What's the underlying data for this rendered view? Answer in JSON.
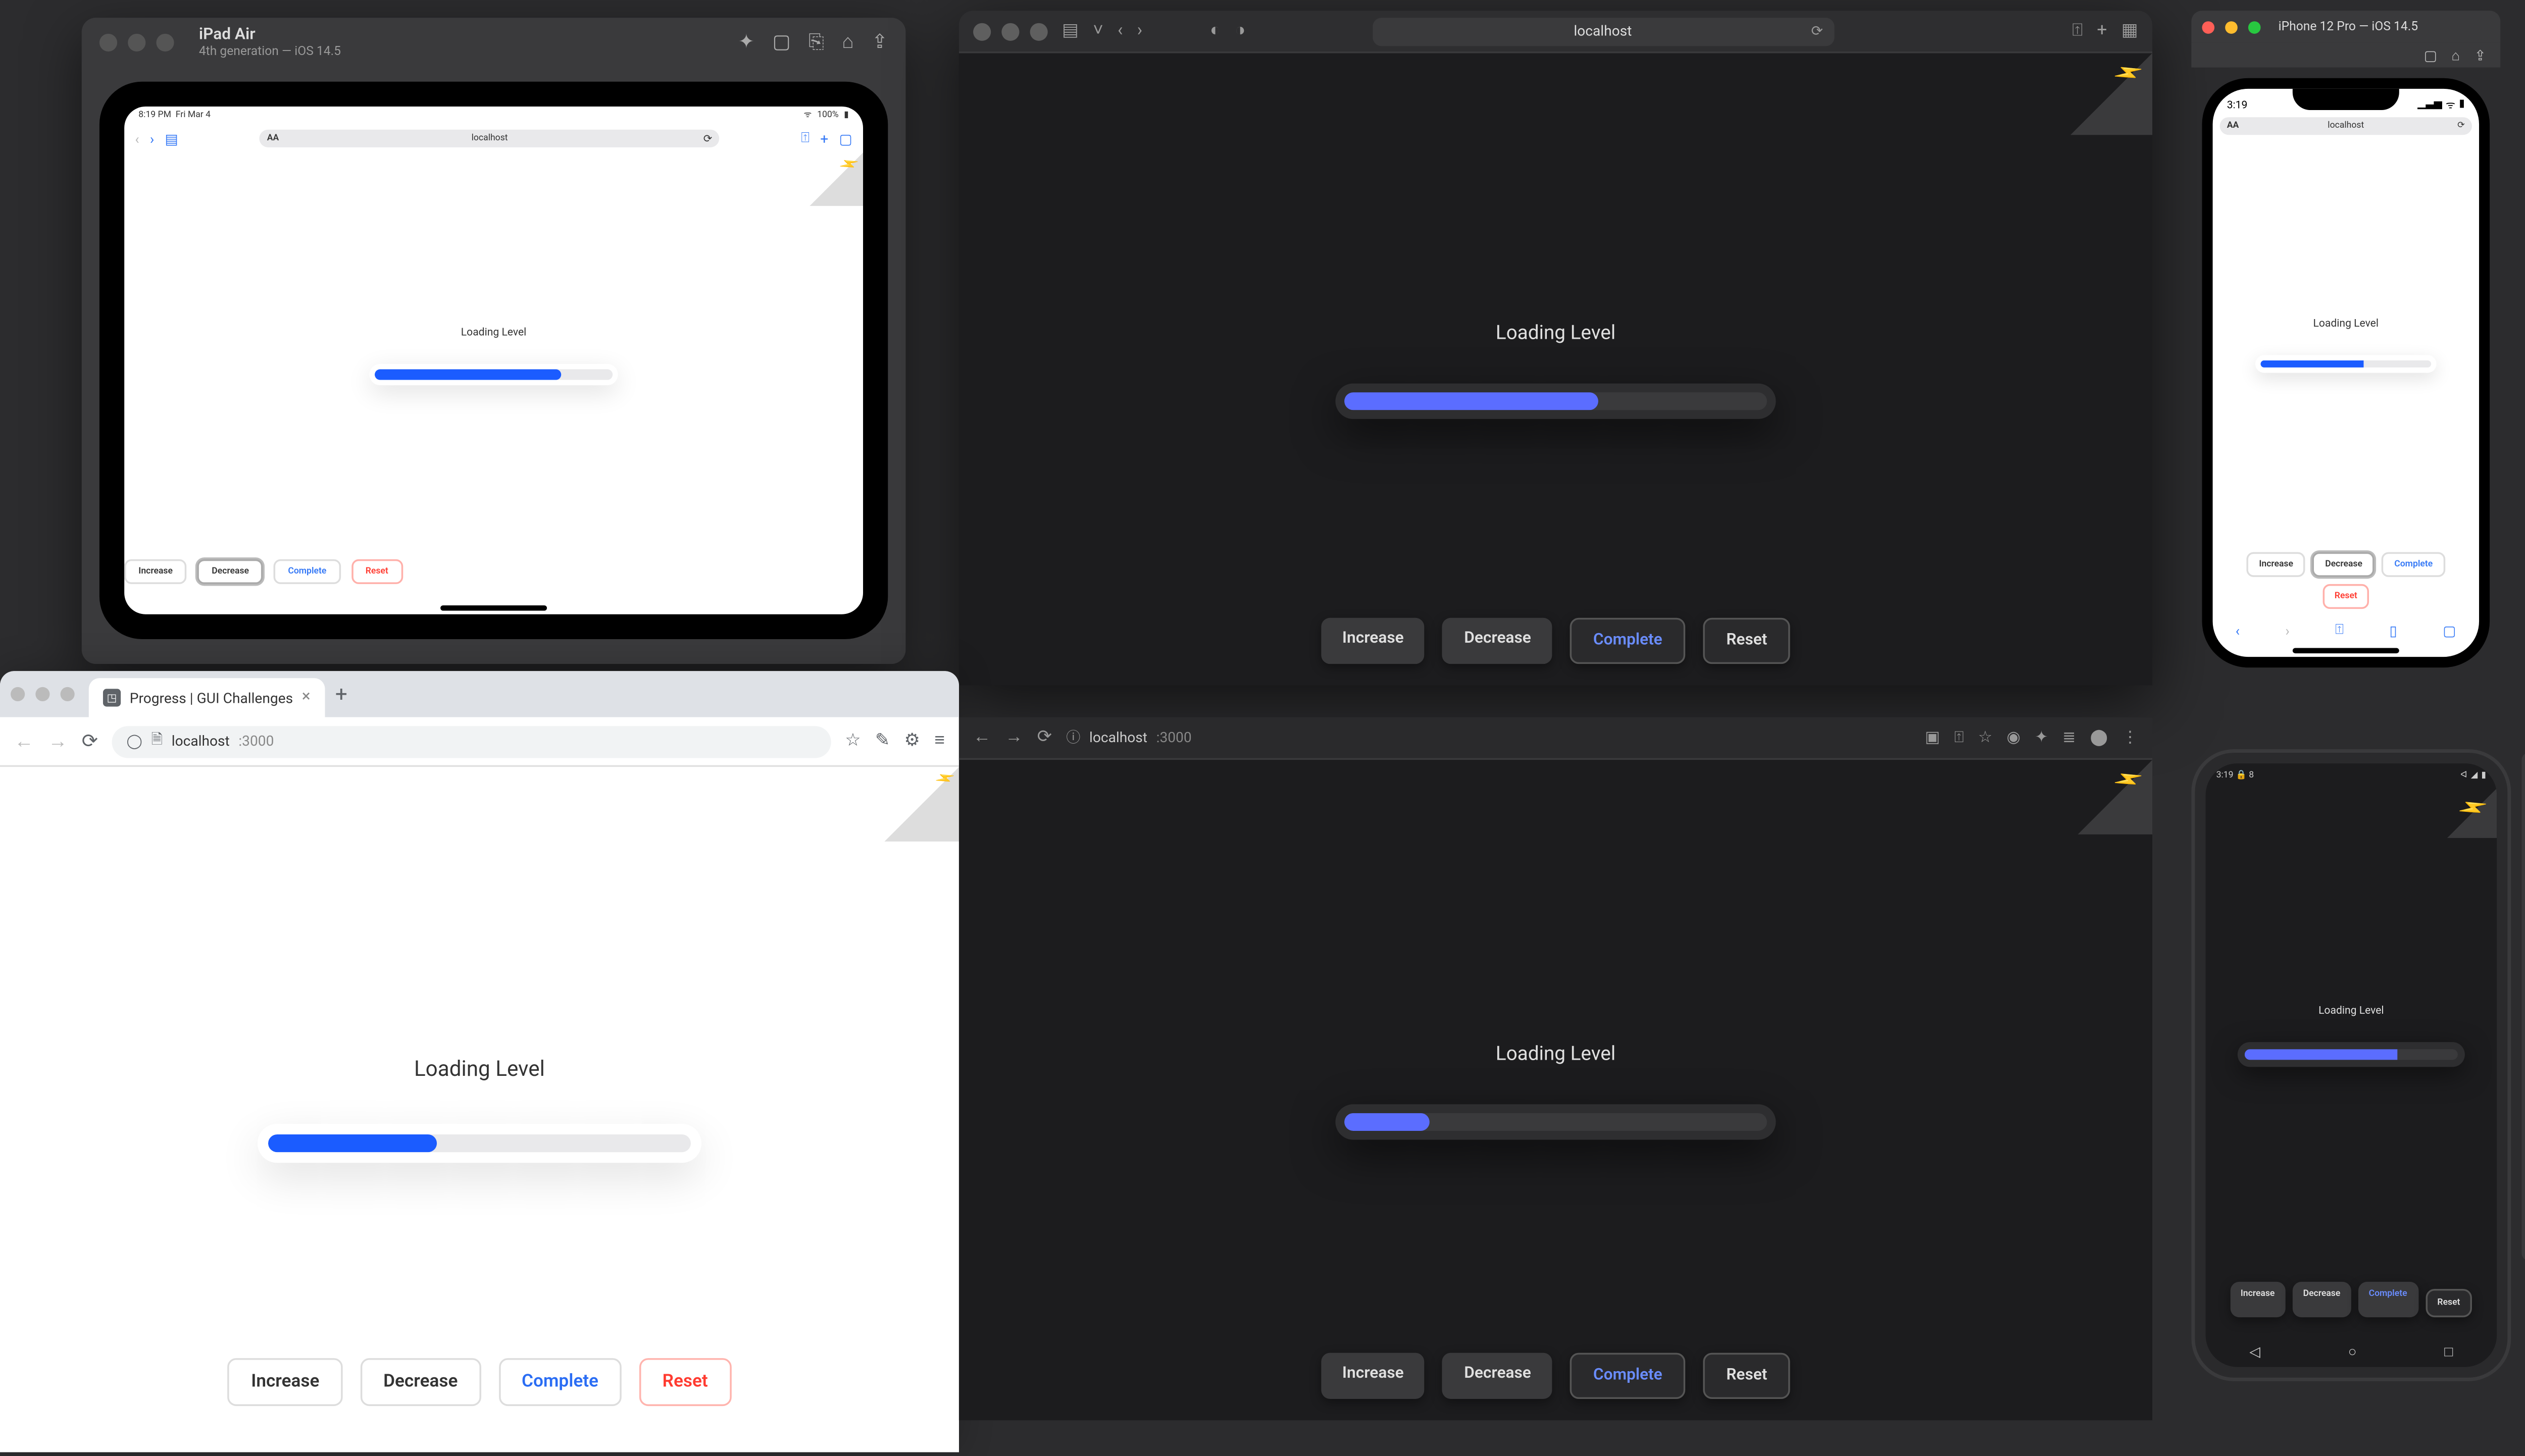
{
  "demo": {
    "loading_label": "Loading Level",
    "buttons": {
      "increase": "Increase",
      "decrease": "Decrease",
      "complete": "Complete",
      "reset": "Reset"
    },
    "progress": {
      "ipad_pct": 78,
      "safari_pct": 60,
      "chrome_light_pct": 40,
      "chrome_dark_pct": 20,
      "iphone_pct": 60,
      "android_pct": 72
    }
  },
  "ipad": {
    "title": "iPad Air",
    "subtitle": "4th generation — iOS 14.5",
    "status_time": "8:19 PM",
    "status_date": "Fri Mar 4",
    "status_wifi": "⊙",
    "status_batt_text": "100%",
    "url": "localhost"
  },
  "safari": {
    "url": "localhost"
  },
  "iphone": {
    "title": "iPhone 12 Pro — iOS 14.5",
    "status_time": "3:19",
    "url": "localhost"
  },
  "chrome_light": {
    "tab_title": "Progress | GUI Challenges",
    "url_host": "localhost",
    "url_port": ":3000"
  },
  "chrome_dark": {
    "url_host": "localhost",
    "url_port": ":3000"
  },
  "android": {
    "status_time": "3:19",
    "status_icon": "🔒",
    "status_extra": "8"
  }
}
